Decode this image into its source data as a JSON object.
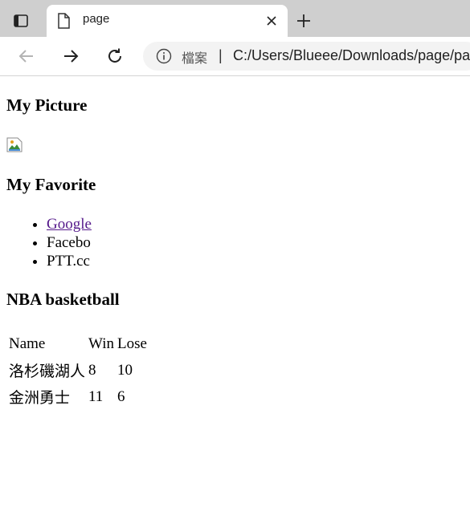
{
  "browser": {
    "tab": {
      "title": "page"
    },
    "address": {
      "site_label": "檔案",
      "separator": "|",
      "url": "C:/Users/Blueee/Downloads/page/page.html"
    }
  },
  "page": {
    "sections": {
      "picture_heading": "My Picture",
      "favorite_heading": "My Favorite",
      "nba_heading": "NBA basketball"
    },
    "favorites": [
      {
        "label": "Google"
      },
      {
        "label": "Facebo"
      },
      {
        "label": "PTT.cc"
      }
    ],
    "nba_table": {
      "headers": [
        "Name",
        "Win",
        "Lose"
      ],
      "rows": [
        [
          "洛杉磯湖人",
          "8",
          "10"
        ],
        [
          "金洲勇士",
          "11",
          "6"
        ]
      ]
    }
  }
}
